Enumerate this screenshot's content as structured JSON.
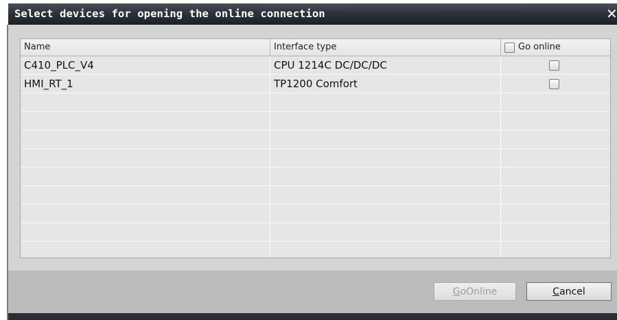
{
  "dialog": {
    "title": "Select devices for opening the online connection",
    "close_glyph": "✕"
  },
  "table": {
    "columns": [
      "Name",
      "Interface type",
      "Go online"
    ],
    "go_online_header_checked": false,
    "rows": [
      {
        "name": "C410_PLC_V4",
        "interface_type": "CPU 1214C DC/DC/DC",
        "go_online": false
      },
      {
        "name": "HMI_RT_1",
        "interface_type": "TP1200 Comfort",
        "go_online": false
      }
    ],
    "empty_rows": 9
  },
  "buttons": {
    "goonline": {
      "mnemonic": "G",
      "rest": "oOnline",
      "enabled": false
    },
    "cancel": {
      "mnemonic": "C",
      "rest": "ancel",
      "enabled": true
    }
  },
  "colors": {
    "title_bar": "#2e333a",
    "body_bg": "#d4d4d4",
    "footer_bg": "#bcbcbc",
    "table_bg": "#e6e6e6",
    "disabled_text": "#9c9c9c"
  },
  "icons": {
    "close": "close-icon",
    "checkbox": "checkbox-icon"
  }
}
